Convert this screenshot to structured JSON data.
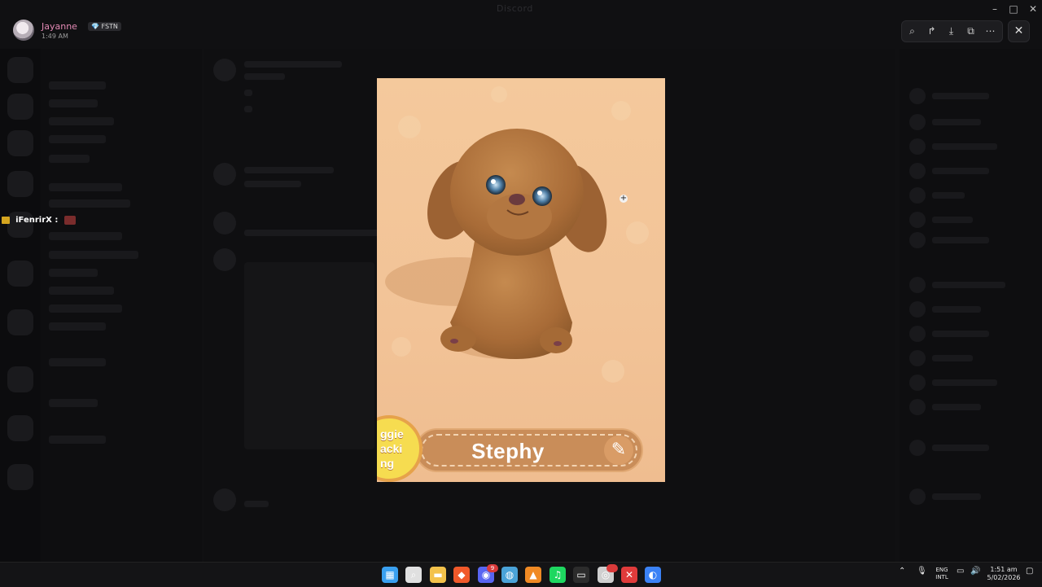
{
  "window": {
    "title": "Discord",
    "controls": [
      "minimize",
      "maximize",
      "close"
    ]
  },
  "uploader": {
    "name": "Jayanne",
    "tag": "💎 FSTN",
    "time": "1:49 AM"
  },
  "overlay_user": {
    "name": "iFenrirX :"
  },
  "viewer_toolbar": {
    "icons": [
      "zoom-icon",
      "forward-icon",
      "download-icon",
      "open-external-icon",
      "more-icon"
    ],
    "close_label": "✕"
  },
  "image": {
    "pet_name": "Stephy",
    "brand_text": "ggie\nacki\nng",
    "edit_icon": "✎"
  },
  "taskbar": {
    "apps": [
      {
        "name": "windows-start",
        "glyph": "▦",
        "color": "#3aa0f0"
      },
      {
        "name": "search",
        "glyph": "⌕",
        "color": "#e0e0e0"
      },
      {
        "name": "file-explorer",
        "glyph": "▬",
        "color": "#f3c24b"
      },
      {
        "name": "brave",
        "glyph": "◆",
        "color": "#f1592a"
      },
      {
        "name": "discord",
        "glyph": "◉",
        "color": "#5865f2",
        "badge": "9"
      },
      {
        "name": "steam",
        "glyph": "◍",
        "color": "#4aa3d8"
      },
      {
        "name": "app-orange",
        "glyph": "▲",
        "color": "#f08a24"
      },
      {
        "name": "spotify",
        "glyph": "♫",
        "color": "#1ed760"
      },
      {
        "name": "terminal",
        "glyph": "▭",
        "color": "#2c2c2c"
      },
      {
        "name": "obs",
        "glyph": "◎",
        "color": "#cfcfcf",
        "badge": ""
      },
      {
        "name": "app-red",
        "glyph": "✕",
        "color": "#e03b3b"
      },
      {
        "name": "chrome",
        "glyph": "◐",
        "color": "#3b82f6"
      }
    ],
    "lang": "ENG\nINTL",
    "time": "1:51 am",
    "date": "5/02/2026"
  }
}
